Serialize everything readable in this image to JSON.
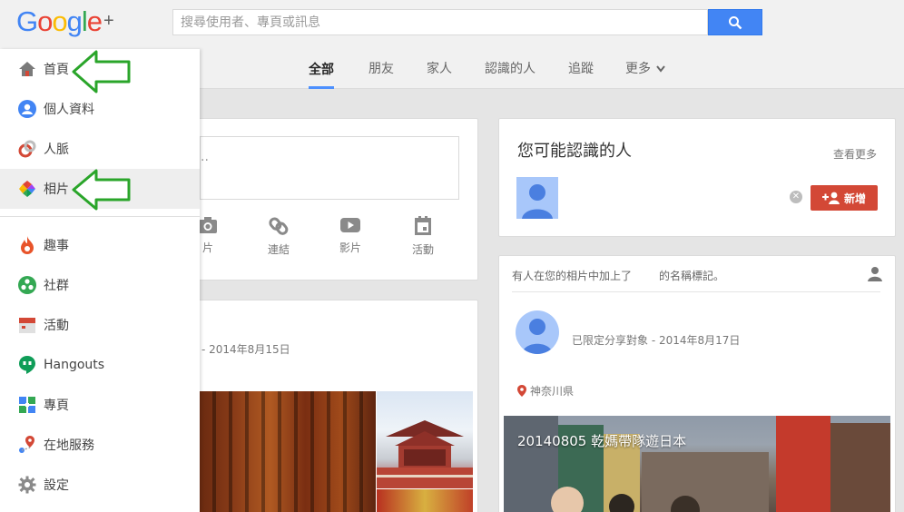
{
  "header": {
    "logo_text": "Google",
    "logo_plus": "+",
    "search_placeholder": "搜尋使用者、專頁或訊息"
  },
  "nav": {
    "tabs": [
      {
        "label": "全部",
        "active": true
      },
      {
        "label": "朋友",
        "active": false
      },
      {
        "label": "家人",
        "active": false
      },
      {
        "label": "認識的人",
        "active": false
      },
      {
        "label": "追蹤",
        "active": false
      },
      {
        "label": "更多",
        "active": false
      }
    ]
  },
  "sidemenu": {
    "items": [
      {
        "label": "首頁",
        "icon": "home-icon"
      },
      {
        "label": "個人資料",
        "icon": "profile-icon"
      },
      {
        "label": "人脈",
        "icon": "people-icon"
      },
      {
        "label": "相片",
        "icon": "photos-icon"
      },
      {
        "label": "趣事",
        "icon": "whats-hot-icon"
      },
      {
        "label": "社群",
        "icon": "communities-icon"
      },
      {
        "label": "活動",
        "icon": "events-icon"
      },
      {
        "label": "Hangouts",
        "icon": "hangouts-icon"
      },
      {
        "label": "專頁",
        "icon": "pages-icon"
      },
      {
        "label": "在地服務",
        "icon": "local-icon"
      },
      {
        "label": "設定",
        "icon": "settings-icon"
      }
    ]
  },
  "share": {
    "placeholder_fragment": "..",
    "actions": [
      {
        "label": "相片",
        "visible_label": "相片",
        "icon": "camera-icon"
      },
      {
        "label": "連結",
        "icon": "link-icon"
      },
      {
        "label": "影片",
        "icon": "video-icon"
      },
      {
        "label": "活動",
        "icon": "event-icon"
      }
    ]
  },
  "left_post": {
    "meta": "- 2014年8月15日"
  },
  "pymk": {
    "title": "您可能認識的人",
    "see_more": "查看更多",
    "add_label": "新增"
  },
  "right_post": {
    "notice_part1": "有人在您的相片中加上了",
    "notice_part2": "的名稱標記。",
    "meta": "已限定分享對象 - 2014年8月17日",
    "location": "神奈川県",
    "photo_title": "20140805 乾媽帶隊遊日本"
  },
  "colors": {
    "accent_blue": "#4285f4",
    "add_red": "#d34836",
    "arrow_green": "#2aa52a"
  }
}
